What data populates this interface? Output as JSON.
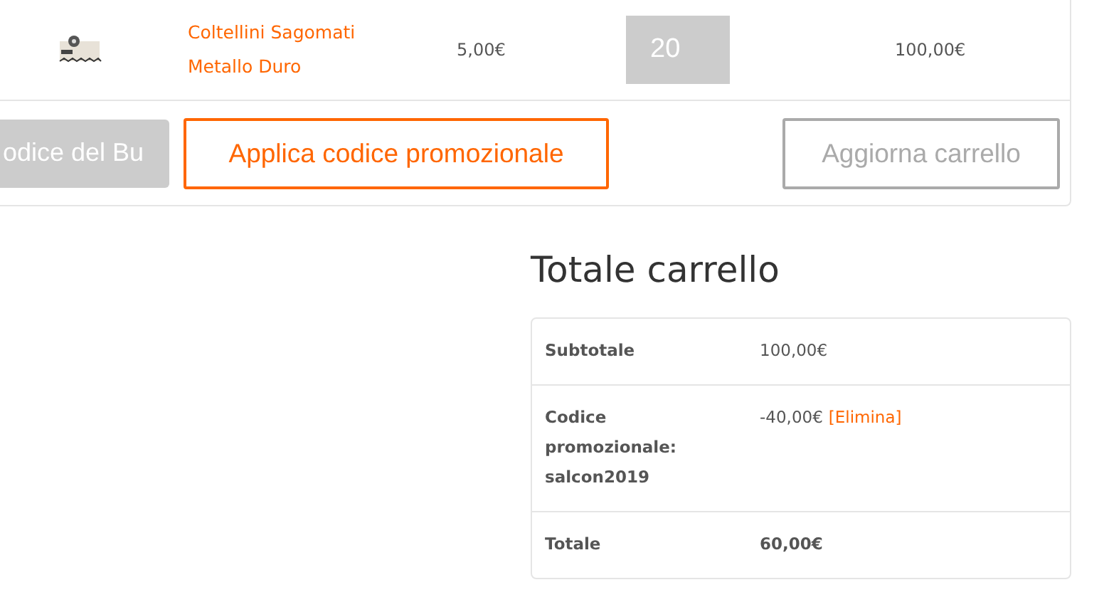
{
  "cart": {
    "items": [
      {
        "name_lines": [
          "Coltellini Sagomati",
          "Metallo Duro"
        ],
        "price": "5,00€",
        "quantity": "20",
        "subtotal": "100,00€"
      }
    ],
    "coupon": {
      "placeholder": "odice del Bu"
    },
    "buttons": [
      {
        "label": "Applica codice promozionale",
        "kind": "primary"
      },
      {
        "label": "Aggiorna carrello",
        "kind": "secondary"
      }
    ]
  },
  "totals": {
    "title": "Totale carrello",
    "rows": [
      {
        "label_lines": [
          "Subtotale"
        ],
        "value": "100,00€",
        "bold": false
      },
      {
        "label_lines": [
          "Codice",
          "promozionale:",
          "salcon2019"
        ],
        "value": "-40,00€",
        "link": "[Elimina]",
        "bold": false
      },
      {
        "label_lines": [
          "Totale"
        ],
        "value": "60,00€",
        "bold": true
      }
    ]
  }
}
